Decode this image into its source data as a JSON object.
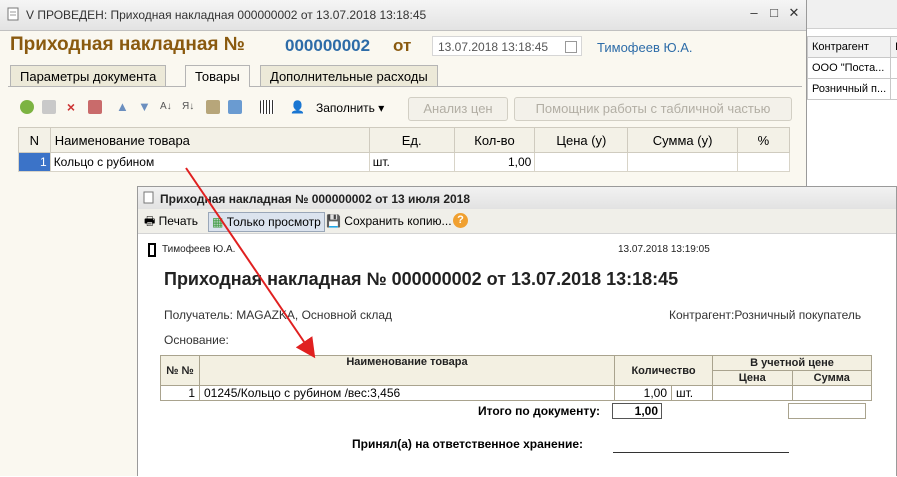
{
  "background_list": {
    "header": [
      "Контрагент",
      "Н"
    ],
    "rows": [
      [
        "ООО \"Поста...",
        ""
      ],
      [
        "Розничный п...",
        ""
      ]
    ]
  },
  "main_window": {
    "title": "V ПРОВЕДЕН: Приходная накладная 000000002 от 13.07.2018 13:18:45",
    "form_title": "Приходная накладная №",
    "number": "000000002",
    "ot": "от",
    "date": "13.07.2018 13:18:45",
    "author": "Тимофеев Ю.А.",
    "tabs": [
      "Параметры документа",
      "Товары",
      "Дополнительные расходы"
    ],
    "active_tab": "Товары",
    "toolbar": {
      "fill_label": "Заполнить",
      "price_analysis": "Анализ цен",
      "assistant": "Помощник работы с табличной частью"
    },
    "grid": {
      "columns": [
        "N",
        "Наименование товара",
        "Ед.",
        "Кол-во",
        "Цена (у)",
        "Сумма (у)",
        "%"
      ],
      "rows": [
        {
          "n": "1",
          "name": "Кольцо с рубином",
          "unit": "шт.",
          "qty": "1,00",
          "price": "",
          "sum": "",
          "pct": ""
        }
      ]
    }
  },
  "print_window": {
    "title": "Приходная накладная № 000000002 от 13 июля 2018",
    "toolbar": {
      "print": "Печать",
      "view_only": "Только просмотр",
      "save_copy": "Сохранить копию...",
      "help": "?"
    },
    "doc": {
      "author": "Тимофеев Ю.А.",
      "printed_at": "13.07.2018 13:19:05",
      "title": "Приходная накладная № 000000002 от 13.07.2018 13:18:45",
      "recipient": "Получатель: MAGAZKA, Основной склад",
      "counterparty": "Контрагент:Розничный покупатель",
      "basis": "Основание:",
      "table_headers": {
        "no": "№ №",
        "name": "Наименование товара",
        "qty": "Количество",
        "acc_price": "В учетной цене",
        "price": "Цена",
        "sum": "Сумма"
      },
      "rows": [
        {
          "no": "1",
          "name": "01245/Кольцо с рубином /вес:3,456",
          "qty": "1,00",
          "unit": "шт.",
          "price": "",
          "sum": ""
        }
      ],
      "total_label": "Итого по документу:",
      "total_value": "1,00",
      "accepted_label": "Принял(а) на ответственное хранение:"
    }
  },
  "colors": {
    "accent_brown": "#8a5a0f",
    "accent_blue": "#2d6ca8",
    "arrow_red": "#e02020"
  }
}
